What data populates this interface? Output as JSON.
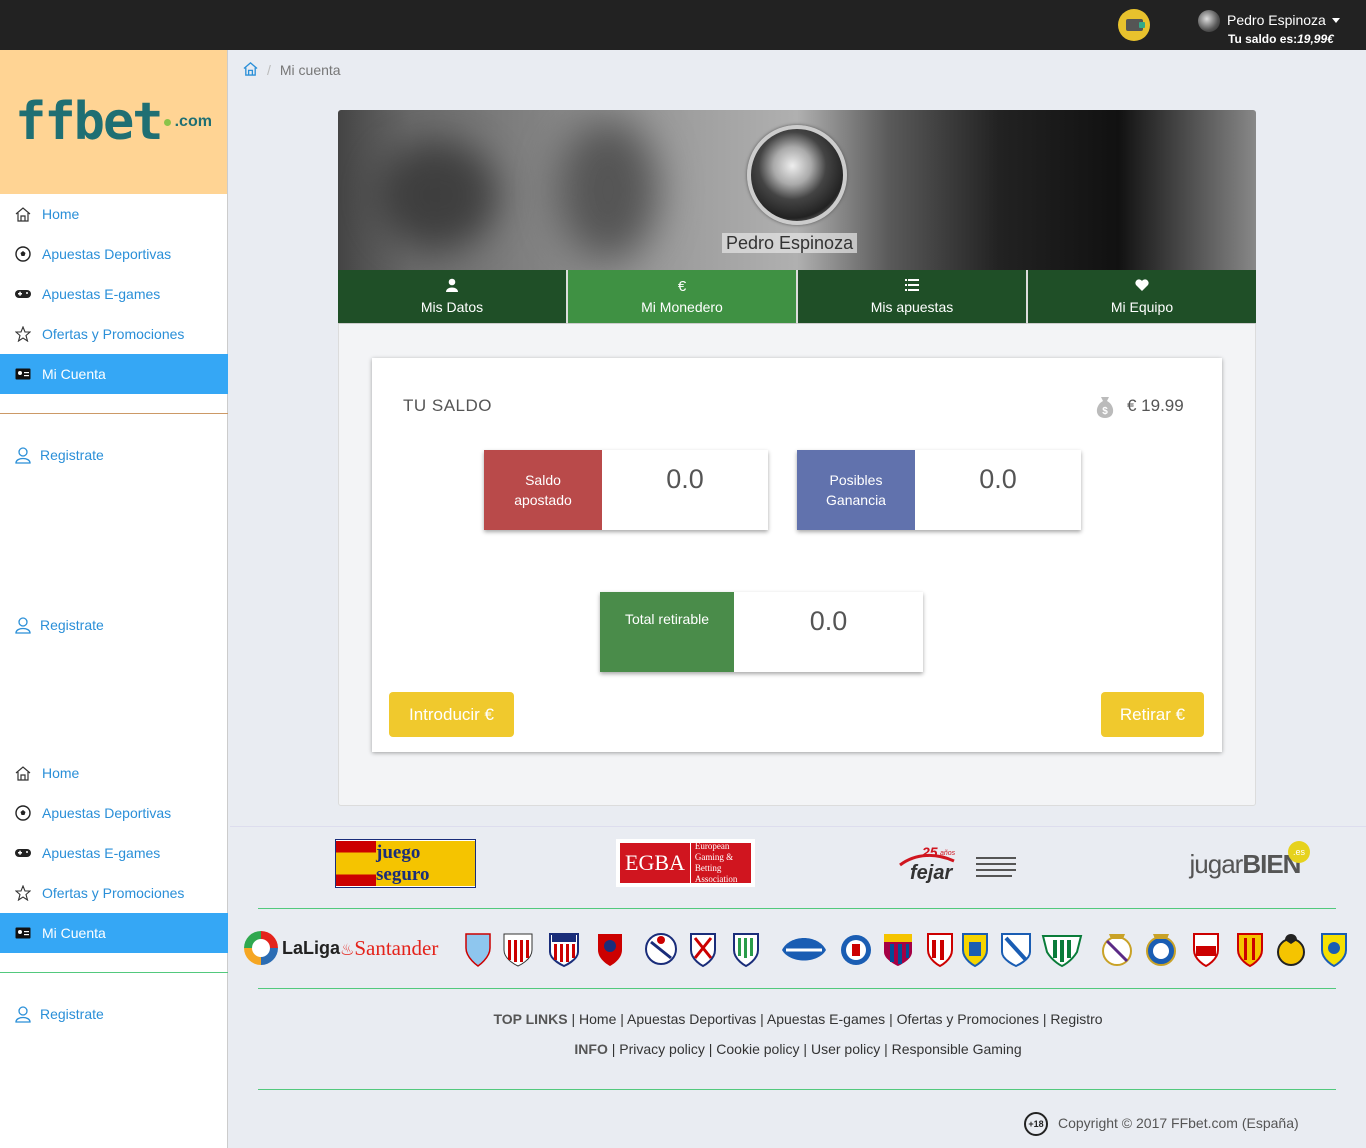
{
  "topbar": {
    "user_name": "Pedro Espinoza",
    "saldo_label": "Tu saldo es:",
    "saldo_value": "19,99€"
  },
  "sidebar": {
    "logo_text": "ffbet",
    "logo_suffix": ".com",
    "menu_1": [
      "Home",
      "Apuestas Deportivas",
      "Apuestas E-games",
      "Ofertas y Promociones",
      "Mi Cuenta"
    ],
    "register_1": "Registrate",
    "register_2": "Registrate",
    "menu_2": [
      "Home",
      "Apuestas Deportivas",
      "Apuestas E-games",
      "Ofertas y Promociones",
      "Mi Cuenta"
    ],
    "register_3": "Registrate",
    "active_item": "Mi Cuenta"
  },
  "breadcrumb": {
    "current": "Mi cuenta"
  },
  "profile": {
    "name": "Pedro Espinoza"
  },
  "tabs": [
    {
      "label": "Mis Datos",
      "icon": "user-icon"
    },
    {
      "label": "Mi Monedero",
      "icon": "euro-icon",
      "active": true
    },
    {
      "label": "Mis apuestas",
      "icon": "list-icon"
    },
    {
      "label": "Mi Equipo",
      "icon": "heart-icon"
    }
  ],
  "wallet": {
    "title": "TU SALDO",
    "balance": "€ 19.99",
    "saldo_apostado_label_1": "Saldo",
    "saldo_apostado_label_2": "apostado",
    "saldo_apostado_value": "0.0",
    "ganancia_label_1": "Posibles",
    "ganancia_label_2": "Ganancia",
    "ganancia_value": "0.0",
    "retirable_label": "Total retirable",
    "retirable_value": "0.0",
    "deposit_button": "Introducir €",
    "withdraw_button": "Retirar €"
  },
  "footer": {
    "partners": {
      "juego_seguro": "juego seguro",
      "egba": "EGBA",
      "egba_sub_1": "European Gaming &",
      "egba_sub_2": "Betting Association",
      "fejar_years": "25",
      "fejar_word": "años",
      "fejar": "fejar",
      "jugarbien_1": "jugar",
      "jugarbien_2": "BIEN",
      "jugarbien_es": ".es"
    },
    "laliga": "LaLiga",
    "santander": "Santander",
    "top_links_label": "TOP LINKS",
    "top_links": [
      "Home",
      "Apuestas Deportivas",
      "Apuestas E-games",
      "Ofertas y Promociones",
      "Registro"
    ],
    "info_label": "INFO",
    "info_links": [
      "Privacy policy",
      "Cookie policy",
      "User policy",
      "Responsible Gaming"
    ],
    "age_badge": "+18",
    "copyright": "Copyright © 2017 FFbet.com (España)"
  },
  "colors": {
    "saldo_apostado": "#b94a4a",
    "ganancia": "#6172ad",
    "retirable": "#4a8c4a",
    "tab_dark": "#1f4f27",
    "tab_active": "#3f9143",
    "button": "#f0c92d"
  }
}
